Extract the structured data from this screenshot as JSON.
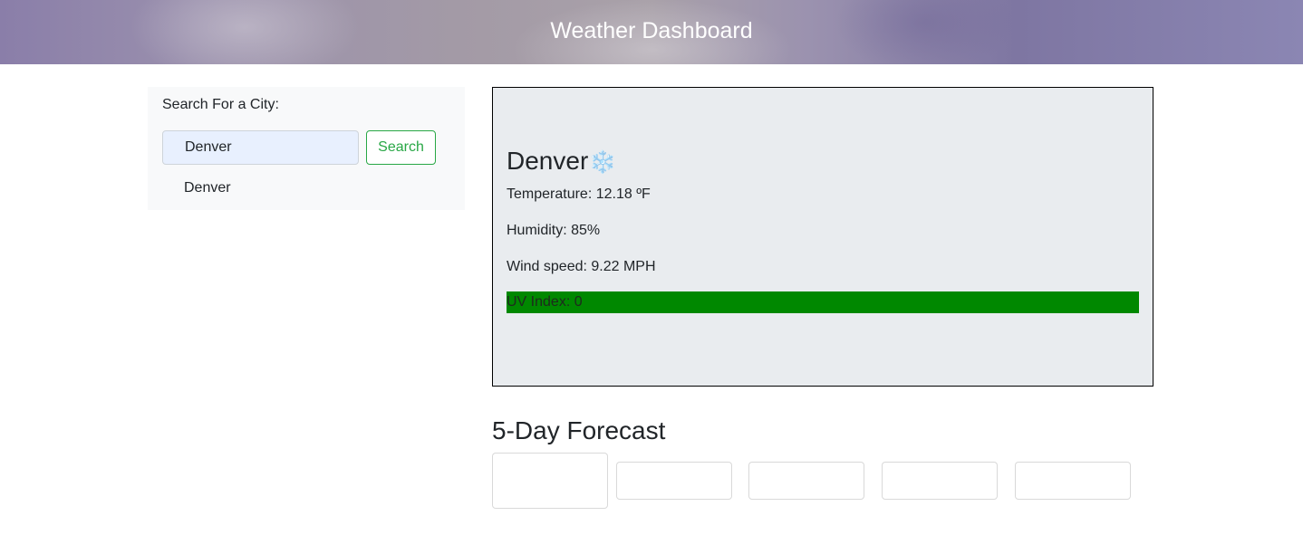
{
  "header": {
    "title": "Weather Dashboard"
  },
  "search": {
    "label": "Search For a City:",
    "input_value": "Denver",
    "button_label": "Search",
    "history": [
      "Denver"
    ]
  },
  "current": {
    "city": "Denver",
    "icon": "snowflake-icon",
    "icon_glyph": "❄️",
    "temperature": "Temperature: 12.18 ºF",
    "humidity": "Humidity: 85%",
    "wind": "Wind speed: 9.22 MPH",
    "uv": "UV Index: 0",
    "uv_color": "#008800"
  },
  "forecast": {
    "title": "5-Day Forecast",
    "days": [
      "",
      "",
      "",
      "",
      ""
    ]
  }
}
